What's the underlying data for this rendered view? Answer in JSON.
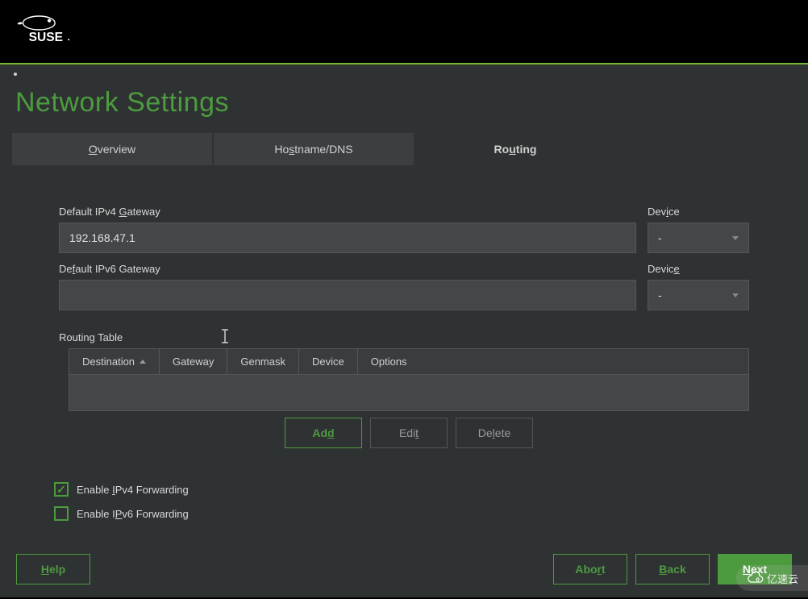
{
  "page": {
    "title": "Network Settings"
  },
  "tabs": {
    "overview": {
      "prefix": "O",
      "rest": "verview"
    },
    "hostname": {
      "prefix": "Ho",
      "u": "s",
      "rest": "tname/DNS"
    },
    "routing": {
      "prefix": "Ro",
      "u": "u",
      "rest": "ting"
    }
  },
  "form": {
    "ipv4_gw": {
      "label_pre": "Default IPv4 ",
      "label_u": "G",
      "label_rest": "ateway",
      "value": "192.168.47.1"
    },
    "ipv6_gw": {
      "label_pre": "De",
      "label_u": "f",
      "label_rest": "ault IPv6 Gateway",
      "value": ""
    },
    "device_label_1": {
      "pre": "Dev",
      "u": "i",
      "rest": "ce"
    },
    "device_label_2": {
      "pre": "Devic",
      "u": "e",
      "rest": ""
    },
    "device_sel_1": "-",
    "device_sel_2": "-"
  },
  "routing_table": {
    "label": "Routing Table",
    "columns": {
      "destination": "Destination",
      "gateway": "Gateway",
      "genmask": "Genmask",
      "device": "Device",
      "options": "Options"
    },
    "rows": []
  },
  "table_buttons": {
    "add": {
      "pre": "Ad",
      "u": "d",
      "rest": ""
    },
    "edit": {
      "pre": "Edi",
      "u": "t",
      "rest": ""
    },
    "delete": {
      "pre": "De",
      "u": "l",
      "rest": "ete"
    }
  },
  "checkboxes": {
    "ipv4_fwd": {
      "checked": true,
      "pre": "Enable ",
      "u": "I",
      "rest": "Pv4 Forwarding"
    },
    "ipv6_fwd": {
      "checked": false,
      "pre": "Enable I",
      "u": "P",
      "rest": "v6 Forwarding"
    }
  },
  "footer": {
    "help": {
      "pre": "",
      "u": "H",
      "rest": "elp"
    },
    "abort": {
      "pre": "Abo",
      "u": "r",
      "rest": "t"
    },
    "back": {
      "pre": "",
      "u": "B",
      "rest": "ack"
    },
    "next": {
      "pre": "",
      "u": "N",
      "rest": "ext"
    }
  },
  "watermark": "亿速云"
}
